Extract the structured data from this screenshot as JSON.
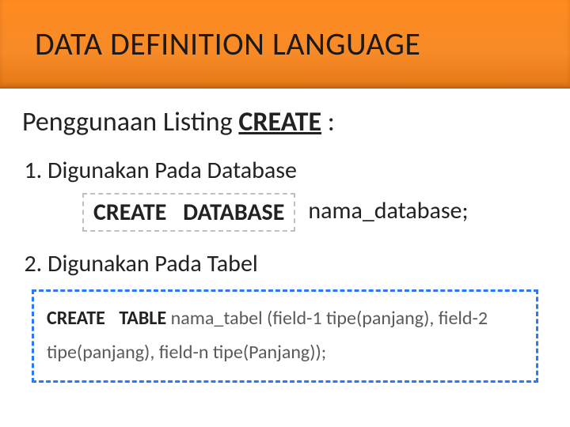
{
  "title": "DATA DEFINITION LANGUAGE",
  "subtitle_prefix": "Penggunaan Listing ",
  "subtitle_keyword": "CREATE",
  "subtitle_suffix": " :",
  "items": {
    "one": {
      "label": "Digunakan Pada Database",
      "syntax_keyword": "CREATE   DATABASE",
      "syntax_arg": "nama_database;"
    },
    "two": {
      "label": "Digunakan Pada Tabel",
      "syntax_keyword": "CREATE  TABLE",
      "syntax_rest": " nama_tabel (field-1 tipe(panjang), field-2 tipe(panjang), field-n tipe(Panjang));"
    }
  }
}
